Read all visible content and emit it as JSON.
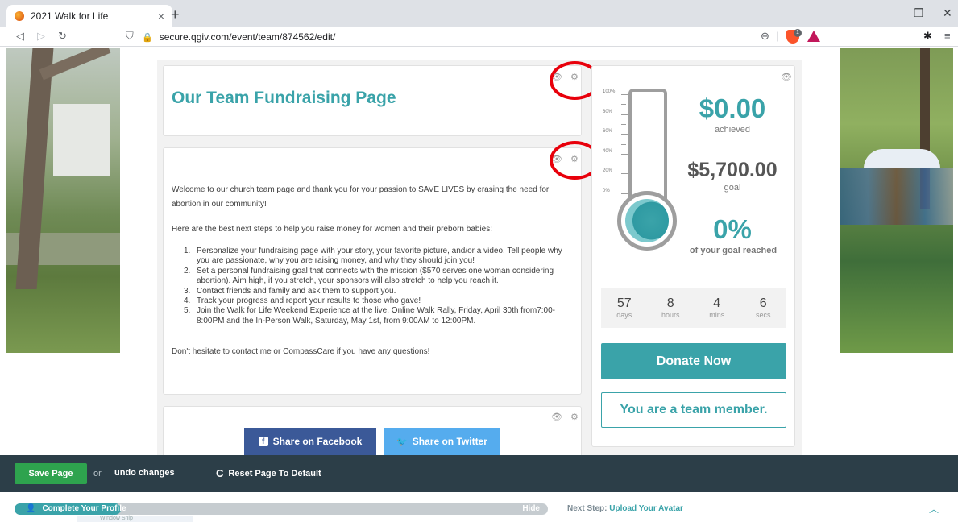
{
  "browser": {
    "tab_title": "2021 Walk for Life",
    "tab_close": "×",
    "new_tab": "+",
    "url": "secure.qgiv.com/event/team/874562/edit/",
    "win_min": "–",
    "win_max": "❐",
    "win_close": "✕"
  },
  "title_card": {
    "title": "Our Team Fundraising Page"
  },
  "text_card": {
    "intro": "Welcome to our church team page and thank you for your passion to SAVE LIVES by erasing the need for abortion in our community!",
    "lead": "Here are the best next steps to help you raise money for women and their preborn babies:",
    "steps": [
      {
        "num": "1.",
        "text": "Personalize your fundraising page with your story, your favorite picture, and/or a video. Tell people why you are passionate, why you are raising money, and why they should join you!"
      },
      {
        "num": "2.",
        "text": "Set a personal fundraising goal that connects with the mission ($570 serves one woman considering abortion). Aim high, if you stretch, your sponsors will also stretch to help you reach it."
      },
      {
        "num": "3.",
        "text": "Contact friends and family and ask them to support you."
      },
      {
        "num": "4.",
        "text": "Track your progress and report your results to those who gave!"
      },
      {
        "num": "5.",
        "text": "Join the Walk for Life Weekend Experience at the live, Online Walk Rally, Friday, April 30th from7:00-8:00PM and the In-Person Walk, Saturday, May 1st, from 9:00AM to 12:00PM."
      }
    ],
    "closing": "Don't hesitate to contact me or CompassCare if you have any questions!"
  },
  "share": {
    "facebook": "Share on Facebook",
    "facebook_icon": "f",
    "twitter": "Share on Twitter",
    "twitter_icon": "🐦"
  },
  "thermometer": {
    "ticks": [
      "100%",
      "80%",
      "60%",
      "40%",
      "20%",
      "0%"
    ],
    "achieved_amount": "$0.00",
    "achieved_label": "achieved",
    "goal_amount": "$5,700.00",
    "goal_label": "goal",
    "percent": "0%",
    "percent_label": "of your goal reached",
    "progress_fraction": 0
  },
  "countdown": [
    {
      "value": "57",
      "unit": "days"
    },
    {
      "value": "8",
      "unit": "hours"
    },
    {
      "value": "4",
      "unit": "mins"
    },
    {
      "value": "6",
      "unit": "secs"
    }
  ],
  "actions": {
    "donate": "Donate Now",
    "member": "You are a team member."
  },
  "editbar": {
    "save": "Save Page",
    "or": "or",
    "undo": "undo changes",
    "reset": "Reset Page To Default",
    "reset_icon": "C"
  },
  "profile": {
    "label": "Complete Your Profile",
    "hide": "Hide",
    "next_prefix": "Next Step:",
    "next_link": "Upload Your Avatar",
    "progress_fraction": 0.2,
    "snip": "Window Snip"
  },
  "colors": {
    "accent": "#3aa3a9",
    "facebook": "#3b5998",
    "twitter": "#55acee",
    "editbar": "#2c3e48",
    "save": "#2ea34e",
    "annotation": "#e8000b"
  }
}
